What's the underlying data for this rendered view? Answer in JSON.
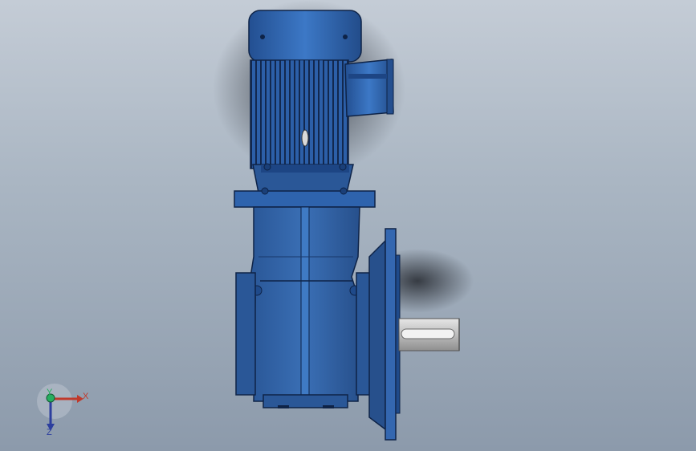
{
  "viewport": {
    "background_top": "#c4ccd6",
    "background_bottom": "#8c9aab"
  },
  "model": {
    "body_color": "#2f67b3",
    "dark_color": "#1a3f78",
    "shaft_color": "#c8c8c8"
  },
  "triad": {
    "x_label": "X",
    "y_label": "Y",
    "z_label": "Z",
    "x_color": "#c0392b",
    "y_color": "#27ae60",
    "z_color": "#2c3e9e"
  }
}
